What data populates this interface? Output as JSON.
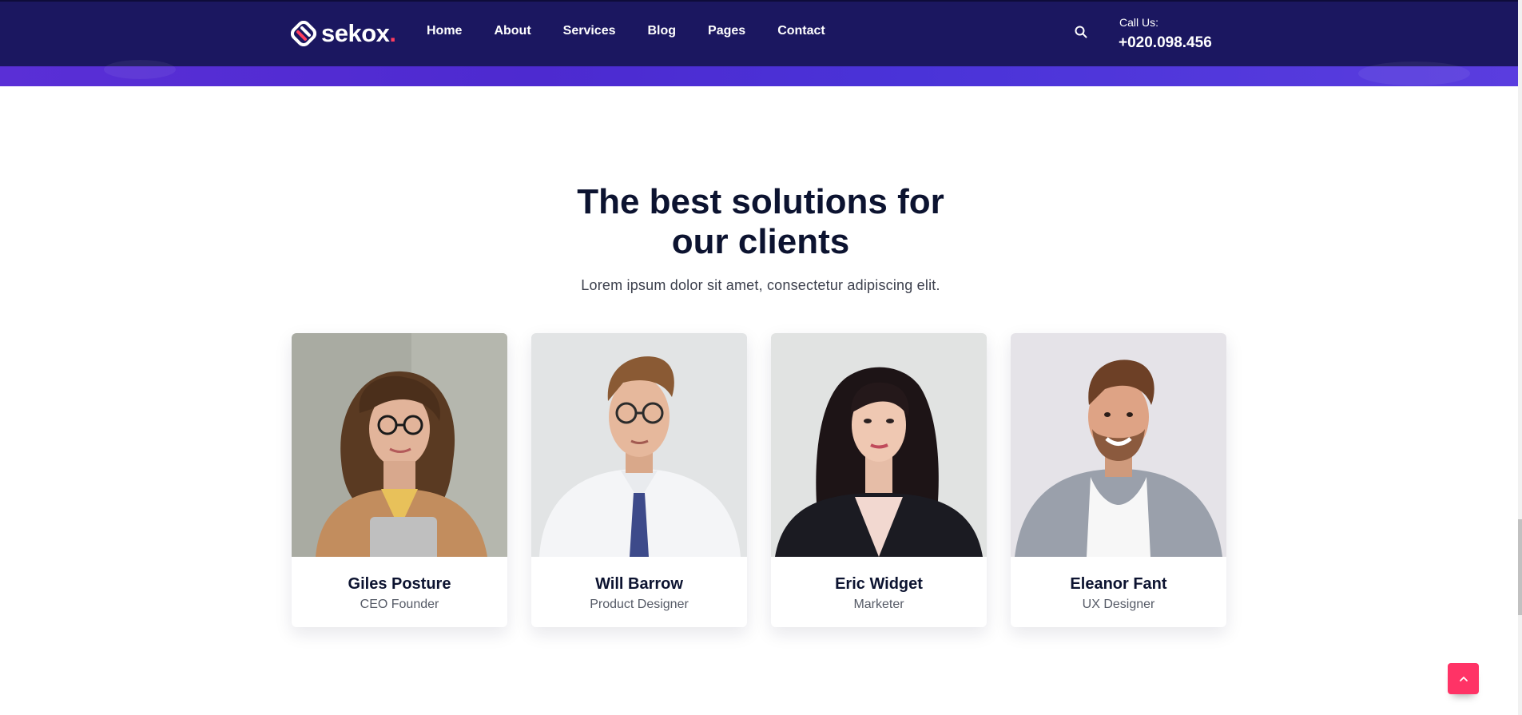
{
  "brand": {
    "name": "sekox",
    "dot": ".",
    "accent": "#ff3d5e",
    "header_bg": "#1b1760"
  },
  "nav": {
    "items": [
      "Home",
      "About",
      "Services",
      "Blog",
      "Pages",
      "Contact"
    ]
  },
  "header": {
    "search_icon": "search-icon",
    "call_label": "Call Us:",
    "call_number": "+020.098.456"
  },
  "section": {
    "title_line1": "The best solutions for",
    "title_line2": "our clients",
    "subtitle": "Lorem ipsum dolor sit amet, consectetur adipiscing elit."
  },
  "team": [
    {
      "name": "Giles Posture",
      "role": "CEO Founder"
    },
    {
      "name": "Will Barrow",
      "role": "Product Designer"
    },
    {
      "name": "Eric Widget",
      "role": "Marketer"
    },
    {
      "name": "Eleanor Fant",
      "role": "UX Designer"
    }
  ],
  "back_to_top": {
    "icon": "chevron-up-icon",
    "color": "#ff3366"
  }
}
